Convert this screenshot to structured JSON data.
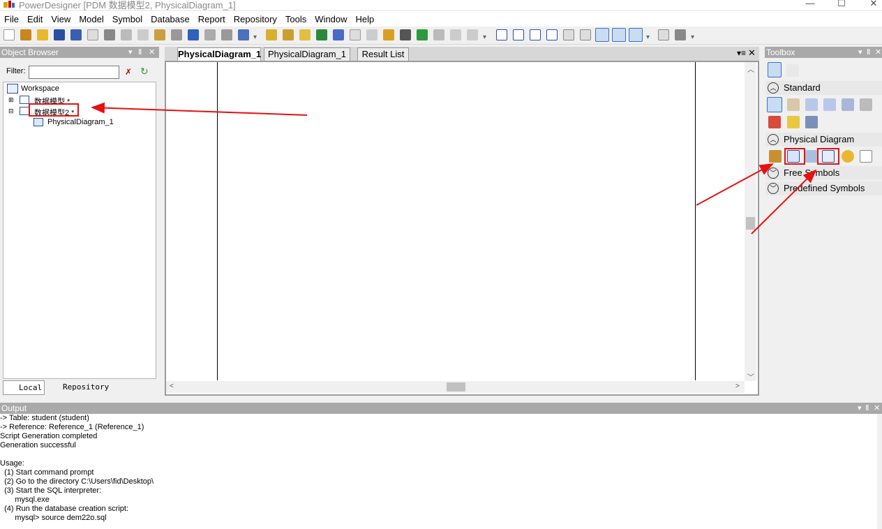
{
  "window": {
    "title": "PowerDesigner [PDM 数据模型2, PhysicalDiagram_1]",
    "minimize": "—",
    "maximize": "☐",
    "close": "✕"
  },
  "menu": [
    "File",
    "Edit",
    "View",
    "Model",
    "Symbol",
    "Database",
    "Report",
    "Repository",
    "Tools",
    "Window",
    "Help"
  ],
  "object_browser": {
    "title": "Object Browser",
    "filter_label": "Filter:",
    "filter_value": "",
    "tree": {
      "workspace": "Workspace",
      "model1": "数据模型 *",
      "model2": "数据模型2 *",
      "diagram": "PhysicalDiagram_1"
    },
    "tabs": {
      "local": "Local",
      "repository": "Repository"
    }
  },
  "doc_tabs": [
    "PhysicalDiagram_1",
    "PhysicalDiagram_1",
    "Result List"
  ],
  "toolbox": {
    "title": "Toolbox",
    "groups": {
      "standard": "Standard",
      "physical": "Physical Diagram",
      "free": "Free Symbols",
      "predefined": "Predefined Symbols"
    }
  },
  "output": {
    "title": "Output",
    "lines": [
      "-> Table: student (student)",
      "-> Reference: Reference_1 (Reference_1)",
      "Script Generation completed",
      "Generation successful",
      "",
      "Usage:",
      "  (1) Start command prompt",
      "  (2) Go to the directory C:\\Users\\fid\\Desktop\\",
      "  (3) Start the SQL interpreter:",
      "       mysql.exe",
      "  (4) Run the database creation script:",
      "       mysql> source dem22o.sql"
    ]
  },
  "colors": {
    "annotation": "#e81010",
    "pane_header": "#a9a9a9"
  }
}
